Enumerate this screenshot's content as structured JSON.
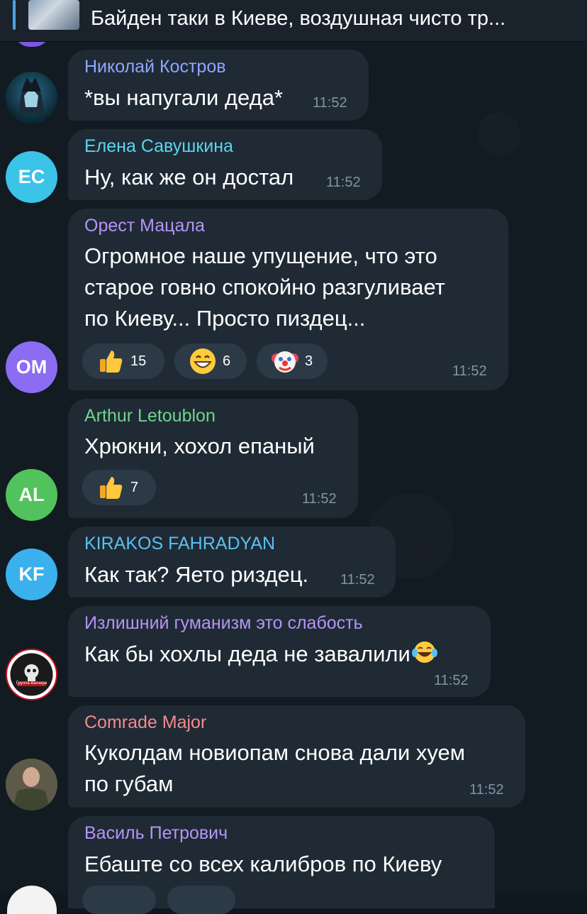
{
  "pinned": {
    "text": "Байден таки в Киеве, воздушная чисто тр..."
  },
  "messages": [
    {
      "author": "Николай Костров",
      "author_color": "#8ea6ff",
      "text": "*вы напугали деда*",
      "time": "11:52"
    },
    {
      "author": "Елена Савушкина",
      "author_color": "#5bd5ee",
      "initials": "EC",
      "avatar_color": "#3cc3e8",
      "text": "Ну, как же он достал",
      "time": "11:52"
    },
    {
      "author": "Орест Мацала",
      "author_color": "#b694f5",
      "initials": "OM",
      "avatar_color": "#8c6cf0",
      "lines": [
        "Огромное наше упущение, что это",
        "старое говно спокойно разгуливает",
        "по Киеву... Просто пиздец..."
      ],
      "reactions": [
        {
          "emoji": "thumbs-up",
          "count": "15"
        },
        {
          "emoji": "grin",
          "count": "6"
        },
        {
          "emoji": "clown",
          "count": "3"
        }
      ],
      "time": "11:52"
    },
    {
      "author": "Arthur Letoublon",
      "author_color": "#6fd58a",
      "initials": "AL",
      "avatar_color": "#52c35c",
      "text": "Хрюкни, хохол епаный",
      "reactions": [
        {
          "emoji": "thumbs-up",
          "count": "7"
        }
      ],
      "time": "11:52"
    },
    {
      "author": "KIRAKOS FAHRADYAN",
      "author_color": "#5bc0ee",
      "initials": "KF",
      "avatar_color": "#3ab0ec",
      "text": "Как так? Яето риздец.",
      "time": "11:52"
    },
    {
      "author": "Излишний гуманизм это слабость",
      "author_color": "#b694f5",
      "text": "Как бы хохлы деда не завалили",
      "emoji": "laughing-tears",
      "avatar_caption": "Группа Вагнера",
      "time": "11:52"
    },
    {
      "author": "Comrade Major",
      "author_color": "#f28b8b",
      "lines": [
        "Куколдам новиопам снова дали хуем",
        "по губам"
      ],
      "time": "11:52"
    },
    {
      "author": "Василь Петрович",
      "author_color": "#b694f5",
      "text": "Ебаште со всех калибров по Киеву"
    }
  ]
}
